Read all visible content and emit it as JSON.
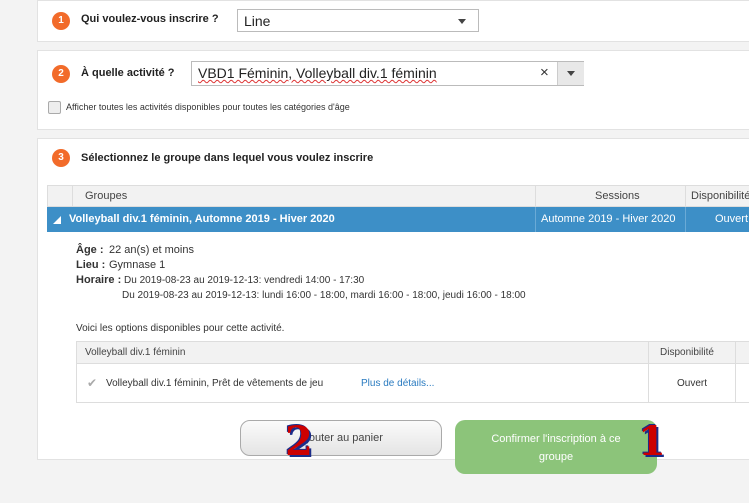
{
  "step1": {
    "num": "1",
    "label": "Qui voulez-vous inscrire ?",
    "value": "Line"
  },
  "step2": {
    "num": "2",
    "label": "À quelle activité ?",
    "value": "VBD1 Féminin, Volleyball div.1 féminin",
    "clear": "×"
  },
  "show_all": "Afficher toutes les activités disponibles pour toutes les catégories d'âge",
  "step3": {
    "num": "3",
    "label": "Sélectionnez le groupe dans lequel vous voulez inscrire"
  },
  "table": {
    "headers": [
      "Groupes",
      "Sessions",
      "Disponibilité"
    ],
    "group_name": "Volleyball div.1 féminin, Automne 2019 - Hiver 2020",
    "group_session": "Automne 2019 - Hiver 2020",
    "group_status": "Ouvert"
  },
  "details": {
    "age_label": "Âge :",
    "age_value": "22 an(s) et moins",
    "lieu_label": "Lieu :",
    "lieu_value": "Gymnase 1",
    "horaire_label": "Horaire :",
    "horaire_1": "Du 2019-08-23 au 2019-12-13: vendredi 14:00 - 17:30",
    "horaire_2": "Du 2019-08-23 au 2019-12-13: lundi 16:00 - 18:00, mardi 16:00 - 18:00, jeudi 16:00 - 18:00"
  },
  "options_intro": "Voici les options disponibles pour cette activité.",
  "options_table": {
    "header_name": "Volleyball div.1 féminin",
    "header_dispo": "Disponibilité",
    "item": "Volleyball div.1 féminin, Prêt de vêtements de jeu",
    "item_link": "Plus de détails...",
    "item_status": "Ouvert"
  },
  "buttons": {
    "cart": "Ajouter au panier",
    "confirm_line1": "Confirmer l'inscription à ce",
    "confirm_line2": "groupe"
  },
  "annotations": {
    "badge_cart": "2",
    "badge_confirm": "1"
  },
  "colors": {
    "accent": "#f26b2a",
    "group_row": "#3d8fc7",
    "confirm_btn": "#8cc47a",
    "link": "#2a7bc0"
  }
}
